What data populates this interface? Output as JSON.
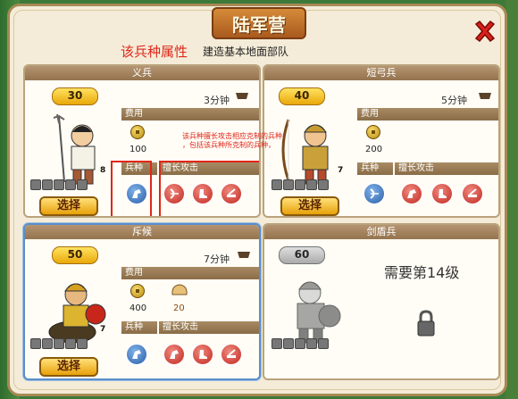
{
  "window": {
    "title": "陆军营",
    "subtitle": "建造基本地面部队"
  },
  "annotations": {
    "unit_attr": "该兵种属性",
    "desc_line1": "该兵种擅长攻击相应克制的兵种",
    "desc_line2": "，包括该兵种所克制的兵种，"
  },
  "labels": {
    "cost": "费用",
    "unit_type": "兵种",
    "specialty": "擅长攻击",
    "select": "选择"
  },
  "cards": [
    {
      "name": "义兵",
      "level": "30",
      "time": "3分钟",
      "cost_gold": "100",
      "quantity": "8"
    },
    {
      "name": "短弓兵",
      "level": "40",
      "time": "5分钟",
      "cost_gold": "200",
      "quantity": "7"
    },
    {
      "name": "斥候",
      "level": "50",
      "time": "7分钟",
      "cost_gold": "400",
      "cost_food": "20",
      "quantity": "7"
    },
    {
      "name": "剑盾兵",
      "level": "60",
      "locked_text": "需要第14级"
    }
  ],
  "colors": {
    "annotation": "#e0261a",
    "selected_border": "#5b8ec9",
    "gold": "#e9a80a"
  }
}
